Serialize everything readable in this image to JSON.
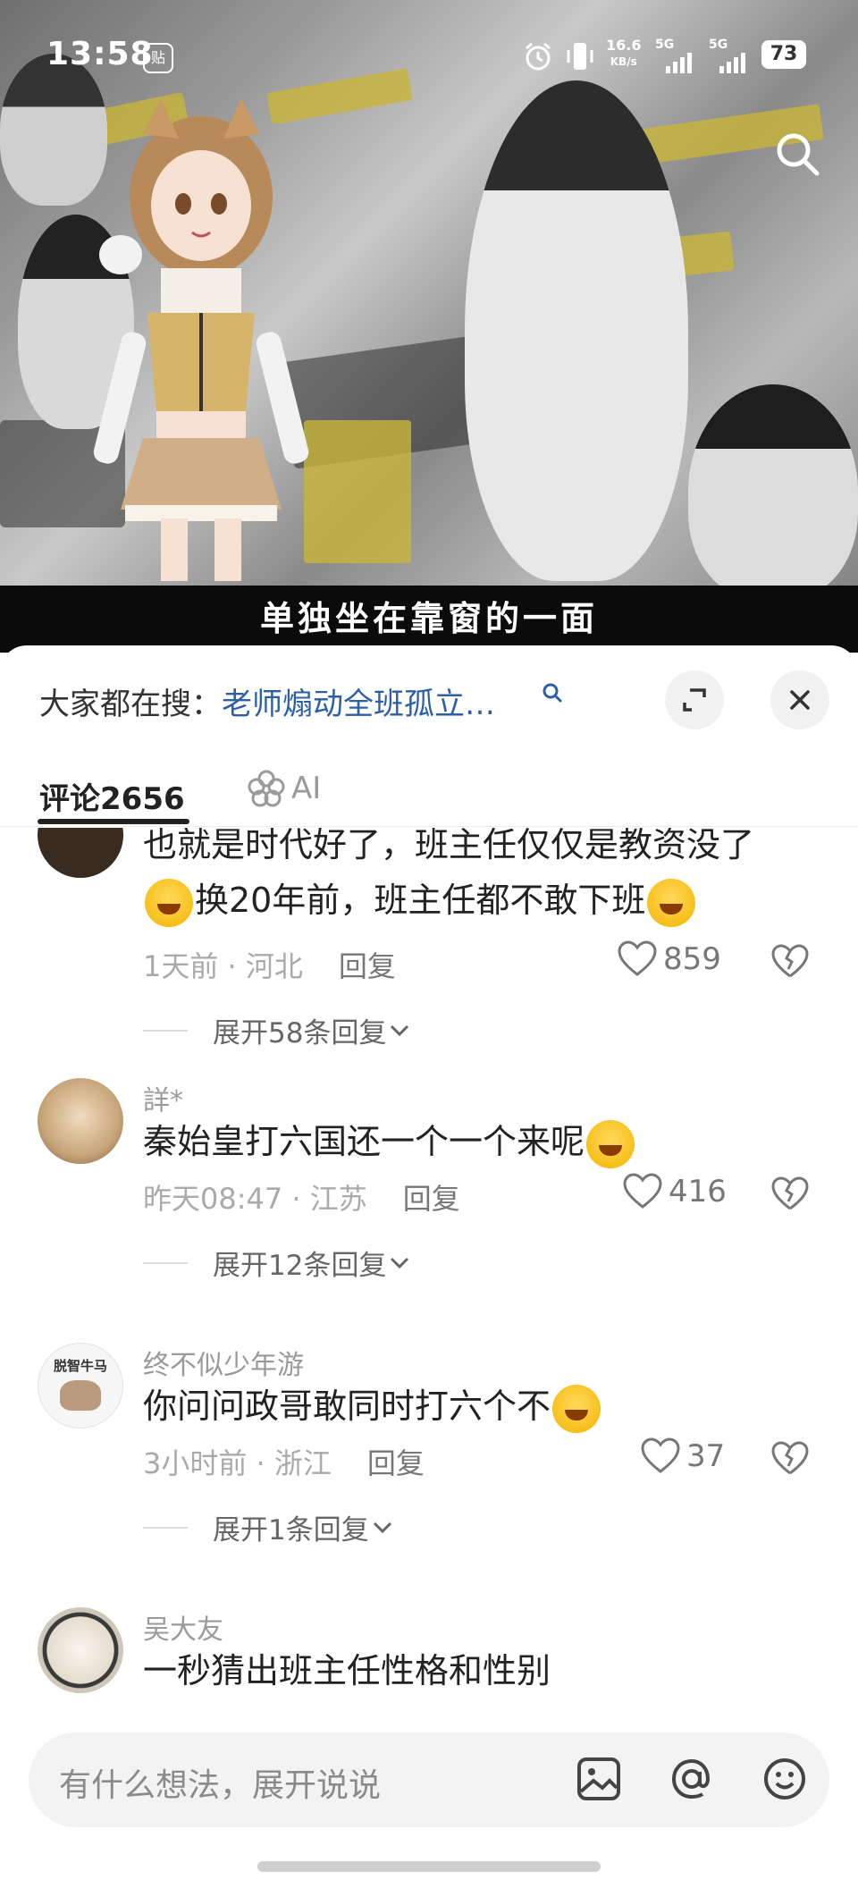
{
  "status_bar": {
    "time": "13:58",
    "notification_badge": "贴",
    "net_speed_value": "16.6",
    "net_speed_unit": "KB/s",
    "sim1": "5G",
    "sim2": "5G",
    "battery": "73"
  },
  "video": {
    "subtitle": "单独坐在靠窗的一面"
  },
  "search_hint": {
    "prefix": "大家都在搜：",
    "query": "老师煽动全班孤立…"
  },
  "tabs": {
    "comments_label": "评论",
    "comments_count": "2656",
    "ai_label": "AI"
  },
  "comments": [
    {
      "username": "",
      "text_line1": "也就是时代好了，班主任仅仅是教资没了",
      "text_line2_pre": "换20年前，班主任都不敢下班",
      "time_location": "1天前 · 河北",
      "reply_label": "回复",
      "likes": "859",
      "expand_label": "展开58条回复"
    },
    {
      "username": "詳*",
      "text": "秦始皇打六国还一个一个来呢",
      "time_location": "昨天08:47 · 江苏",
      "reply_label": "回复",
      "likes": "416",
      "expand_label": "展开12条回复"
    },
    {
      "username": "终不似少年游",
      "avatar_text": "脱智牛马",
      "text": "你问问政哥敢同时打六个不",
      "time_location": "3小时前 · 浙江",
      "reply_label": "回复",
      "likes": "37",
      "expand_label": "展开1条回复"
    },
    {
      "username": "吴大友",
      "text": "一秒猜出班主任性格和性别"
    }
  ],
  "input_bar": {
    "placeholder": "有什么想法，展开说说"
  },
  "icons": {
    "search": "search-icon",
    "close": "close-icon",
    "collapse": "collapse-icon",
    "like": "heart-icon",
    "dislike": "broken-heart-icon",
    "image": "image-icon",
    "mention": "at-icon",
    "emoji": "emoji-icon"
  }
}
